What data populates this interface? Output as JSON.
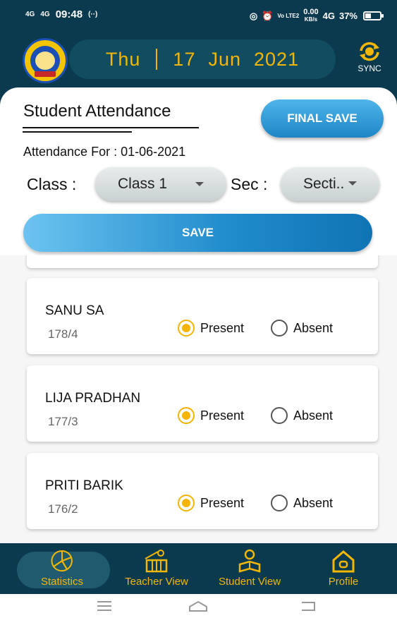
{
  "status_bar": {
    "sig1": "4G",
    "sig2": "4G",
    "time": "09:48",
    "extra": "(··)",
    "net_label": "Vo LTE2",
    "speed": "0.00",
    "speed_unit": "KB/s",
    "net_type": "4G",
    "battery": "37%"
  },
  "header": {
    "day": "Thu",
    "date": "17",
    "month": "Jun",
    "year": "2021",
    "sync_label": "SYNC"
  },
  "form": {
    "title": "Student Attendance",
    "final_save_label": "FINAL SAVE",
    "attendance_for_label": "Attendance For :",
    "attendance_date": "01-06-2021",
    "class_label": "Class :",
    "class_value": "Class 1",
    "sec_label": "Sec :",
    "sec_value": "Secti..",
    "save_label": "SAVE"
  },
  "students": [
    {
      "name": "SANU SA",
      "roll": "178/4",
      "present_label": "Present",
      "absent_label": "Absent",
      "status": "present"
    },
    {
      "name": "LIJA PRADHAN",
      "roll": "177/3",
      "present_label": "Present",
      "absent_label": "Absent",
      "status": "present"
    },
    {
      "name": "PRITI BARIK",
      "roll": "176/2",
      "present_label": "Present",
      "absent_label": "Absent",
      "status": "present"
    }
  ],
  "bottom_nav": {
    "statistics": "Statistics",
    "teacher_view": "Teacher View",
    "student_view": "Student View",
    "profile": "Profile",
    "active": "Statistics"
  },
  "colors": {
    "header_bg": "#0b3a4f",
    "accent": "#f2b705",
    "button_blue": "#1e86c6"
  }
}
